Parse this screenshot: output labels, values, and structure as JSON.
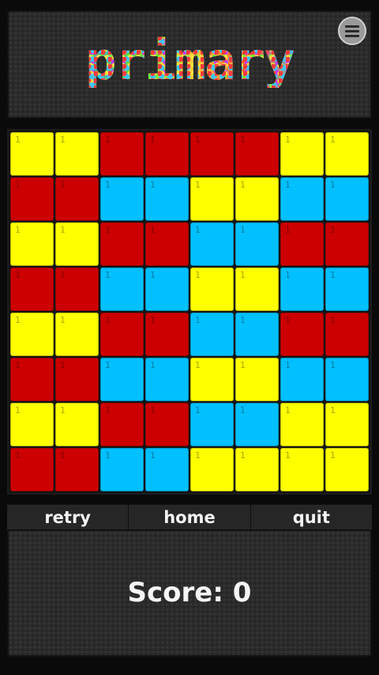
{
  "header": {
    "logo_text": "primary",
    "menu_icon": "hamburger-menu-icon"
  },
  "board": {
    "colors": {
      "Y": "#ffff00",
      "R": "#cc0000",
      "B": "#00c0ff"
    },
    "tile_label": "1",
    "rows": [
      [
        "Y",
        "Y",
        "R",
        "R",
        "R",
        "R",
        "Y",
        "Y"
      ],
      [
        "R",
        "R",
        "B",
        "B",
        "Y",
        "Y",
        "B",
        "B"
      ],
      [
        "Y",
        "Y",
        "R",
        "R",
        "B",
        "B",
        "R",
        "R"
      ],
      [
        "R",
        "R",
        "B",
        "B",
        "Y",
        "Y",
        "B",
        "B"
      ],
      [
        "Y",
        "Y",
        "R",
        "R",
        "B",
        "B",
        "R",
        "R"
      ],
      [
        "R",
        "R",
        "B",
        "B",
        "Y",
        "Y",
        "B",
        "B"
      ],
      [
        "Y",
        "Y",
        "R",
        "R",
        "B",
        "B",
        "Y",
        "Y"
      ],
      [
        "R",
        "R",
        "B",
        "B",
        "Y",
        "Y",
        "Y",
        "Y"
      ]
    ]
  },
  "controls": {
    "retry": "retry",
    "home": "home",
    "quit": "quit"
  },
  "score": {
    "text": "Score: 0"
  }
}
